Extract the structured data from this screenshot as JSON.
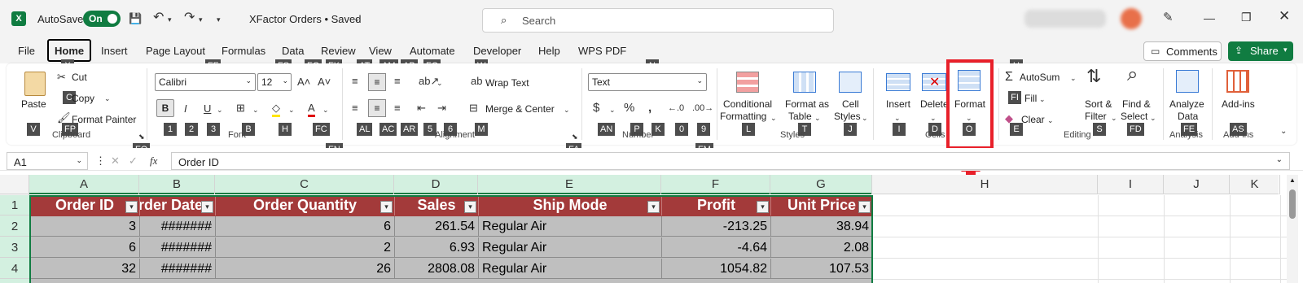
{
  "title": {
    "autosave_label": "AutoSave",
    "autosave_state": "On",
    "doc_title": "XFactor Orders • Saved",
    "search_placeholder": "Search"
  },
  "menu": {
    "tabs": [
      "File",
      "Home",
      "Insert",
      "Page Layout",
      "Formulas",
      "Data",
      "Review",
      "View",
      "Automate",
      "Developer",
      "Help",
      "WPS PDF"
    ],
    "comments": "Comments",
    "share": "Share"
  },
  "keytips": {
    "file_menu": [
      "X",
      "FF",
      "FS",
      "FG",
      "FK",
      "AT",
      "AM",
      "AB",
      "FQ",
      "W",
      "N",
      "U"
    ],
    "clipboard": [
      "C",
      "FP",
      "V",
      "FO"
    ],
    "font": [
      "1",
      "2",
      "3",
      "B",
      "H",
      "FC",
      "FN"
    ],
    "alignment": [
      "AT",
      "AM",
      "AB",
      "FQ",
      "AL",
      "AC",
      "AR",
      "5",
      "6",
      "M",
      "FA"
    ],
    "number": [
      "AN",
      "P",
      "K",
      "0",
      "9",
      "FM"
    ],
    "styles": [
      "L",
      "T",
      "J"
    ],
    "cells": [
      "I",
      "D",
      "O"
    ],
    "editing": [
      "FI",
      "E",
      "S",
      "FD"
    ],
    "analysis": [
      "FE"
    ],
    "addins": [
      "AS"
    ]
  },
  "ribbon": {
    "clipboard": {
      "paste": "Paste",
      "cut": "Cut",
      "copy": "Copy",
      "format_painter": "Format Painter",
      "group": "Clipboard"
    },
    "font": {
      "name": "Calibri",
      "size": "12",
      "group": "Font"
    },
    "alignment": {
      "wrap": "Wrap Text",
      "merge": "Merge & Center",
      "group": "Alignment"
    },
    "number": {
      "format": "Text",
      "group": "Number"
    },
    "styles": {
      "cond1": "Conditional",
      "cond2": "Formatting",
      "table1": "Format as",
      "table2": "Table",
      "cell1": "Cell",
      "cell2": "Styles",
      "group": "Styles"
    },
    "cells": {
      "insert": "Insert",
      "delete": "Delete",
      "format": "Format",
      "group": "Cells"
    },
    "editing": {
      "autosum": "AutoSum",
      "fill": "Fill",
      "clear": "Clear",
      "sort1": "Sort &",
      "sort2": "Filter",
      "find1": "Find &",
      "find2": "Select",
      "group": "Editing"
    },
    "analysis": {
      "a1": "Analyze",
      "a2": "Data",
      "group": "Analysis"
    },
    "addins": {
      "label": "Add-ins",
      "group": "Add-ins"
    }
  },
  "formula_bar": {
    "name_box": "A1",
    "fx": "fx",
    "value": "Order ID"
  },
  "sheet": {
    "columns": [
      "A",
      "B",
      "C",
      "D",
      "E",
      "F",
      "G",
      "H",
      "I",
      "J",
      "K"
    ],
    "rows": [
      "1",
      "2",
      "3",
      "4"
    ],
    "headers": [
      "Order ID",
      "Order Date",
      "Order Quantity",
      "Sales",
      "Ship Mode",
      "Profit",
      "Unit Price"
    ],
    "data": [
      [
        "3",
        "#######",
        "6",
        "261.54",
        "Regular Air",
        "-213.25",
        "38.94"
      ],
      [
        "6",
        "#######",
        "2",
        "6.93",
        "Regular Air",
        "-4.64",
        "2.08"
      ],
      [
        "32",
        "#######",
        "26",
        "2808.08",
        "Regular Air",
        "1054.82",
        "107.53"
      ]
    ]
  },
  "colors": {
    "header_fill": "#a33a3a",
    "highlight": "#e8202a",
    "excel_green": "#107c41",
    "cell_gray": "#bfbfbf"
  }
}
